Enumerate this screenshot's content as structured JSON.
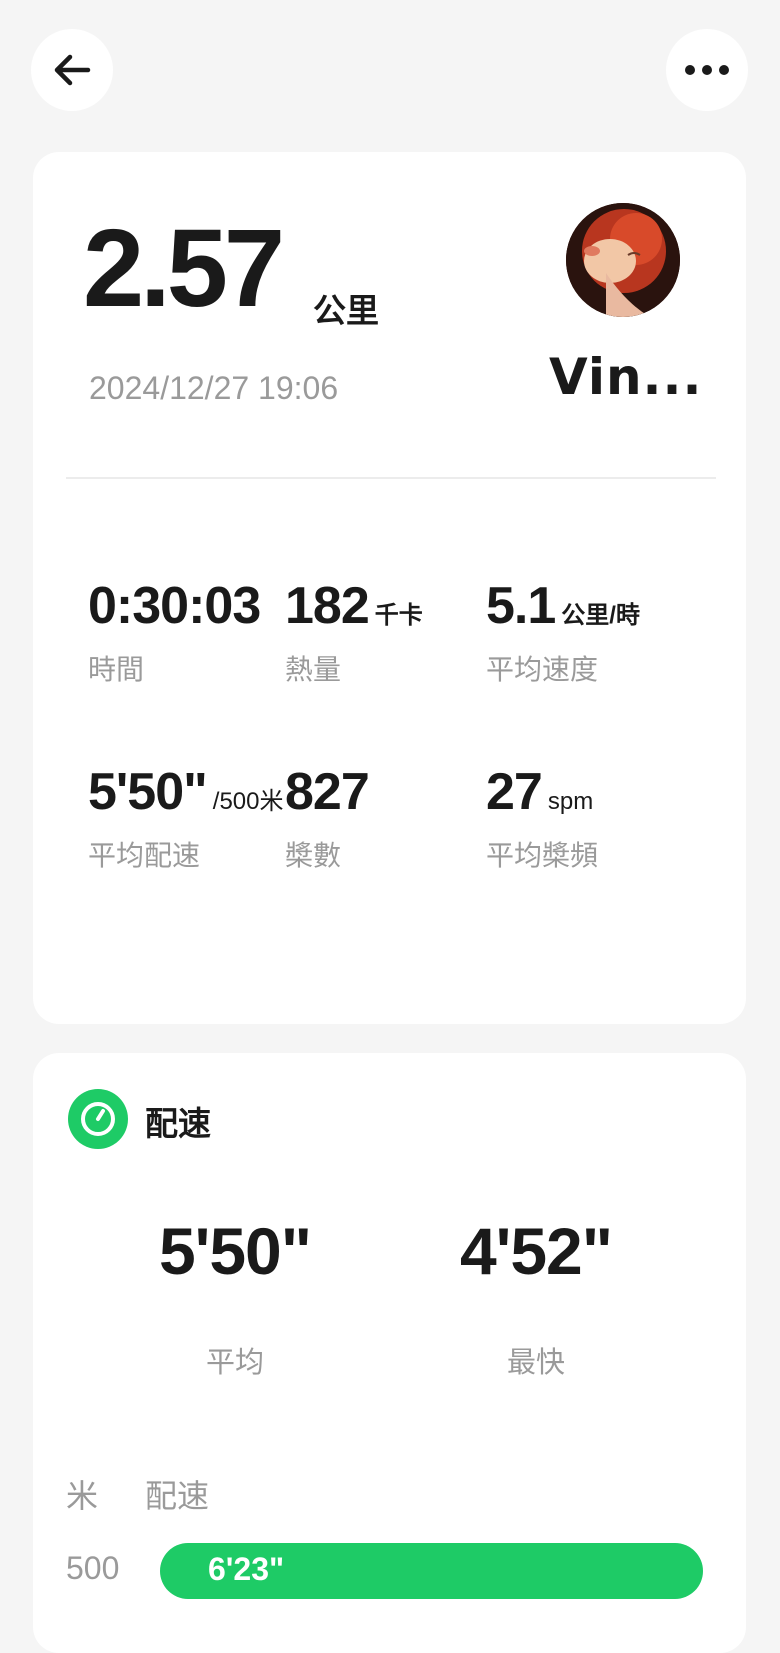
{
  "nav": {
    "back_icon": "arrow-left-icon",
    "more_icon": "more-horizontal-icon"
  },
  "summary": {
    "distance": "2.57",
    "distance_unit": "公里",
    "datetime": "2024/12/27 19:06",
    "user_name": "Vin...",
    "stats": [
      {
        "value": "0:30:03",
        "unit": "",
        "label": "時間"
      },
      {
        "value": "182",
        "unit": "千卡",
        "label": "熱量"
      },
      {
        "value": "5.1",
        "unit": "公里/時",
        "label": "平均速度"
      },
      {
        "value": "5'50\"",
        "unit": "/500米",
        "label": "平均配速"
      },
      {
        "value": "827",
        "unit": "",
        "label": "槳數"
      },
      {
        "value": "27",
        "unit": "spm",
        "label": "平均槳頻"
      }
    ]
  },
  "pace": {
    "title": "配速",
    "icon": "speedometer-icon",
    "accent": "#1ecb66",
    "average_value": "5'50\"",
    "average_label": "平均",
    "fastest_value": "4'52\"",
    "fastest_label": "最快",
    "col_meter": "米",
    "col_pace": "配速",
    "rows": [
      {
        "meter": "500",
        "pace": "6'23\""
      }
    ]
  }
}
